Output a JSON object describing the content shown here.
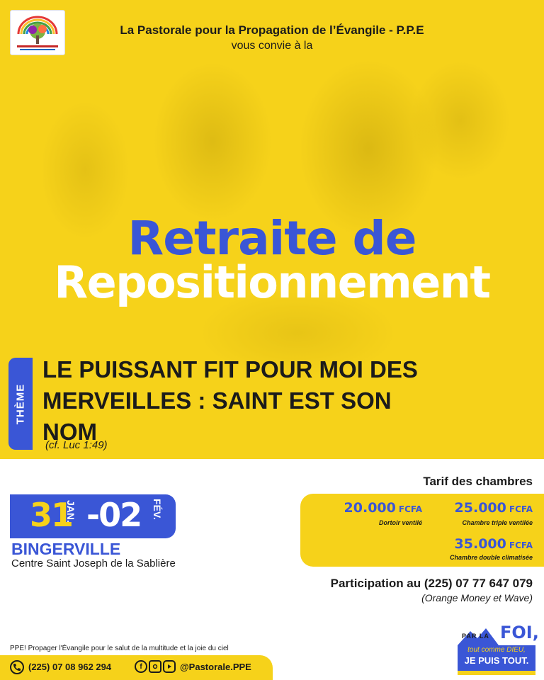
{
  "header": {
    "organizer": "La Pastorale pour la Propagation de l’Évangile - P.P.E",
    "invite": "vous convie à la"
  },
  "event": {
    "title_line1": "Retraite de",
    "title_line2": "Repositionnement"
  },
  "theme": {
    "label": "THÈME",
    "text": "LE PUISSANT FIT POUR MOI DES MERVEILLES : SAINT EST SON NOM",
    "reference": "(cf. Luc 1:49)"
  },
  "dates": {
    "start_day": "31",
    "start_month": "JAN.",
    "separator": "-",
    "end_day": "02",
    "end_month": "FÉV."
  },
  "location": {
    "city": "BINGERVILLE",
    "venue": "Centre Saint Joseph de la Sablière"
  },
  "rates": {
    "title": "Tarif des chambres",
    "items": [
      {
        "amount": "20.000",
        "currency": "FCFA",
        "desc": "Dortoir ventilé"
      },
      {
        "amount": "25.000",
        "currency": "FCFA",
        "desc": "Chambre triple ventilée"
      },
      {
        "amount": "35.000",
        "currency": "FCFA",
        "desc": "Chambre double climatisée"
      }
    ]
  },
  "participation": {
    "text": "Participation au (225) 07 77 647 079",
    "methods": "(Orange Money et Wave)"
  },
  "footer": {
    "slogan": "PPE! Propager l'Évangile pour le salut de la multitude et la joie du ciel",
    "phone": "(225) 07 08 962 294",
    "social_handle": "@Pastorale.PPE",
    "icons": [
      "phone-icon",
      "facebook-icon",
      "instagram-icon",
      "youtube-icon"
    ]
  },
  "badge": {
    "par_la": "PAR LA",
    "foi": "FOI,",
    "line1": "tout comme DIEU,",
    "line2": "JE PUIS TOUT."
  },
  "colors": {
    "yellow": "#f6d21a",
    "blue": "#3a56d6",
    "dark": "#1b1b1b"
  }
}
